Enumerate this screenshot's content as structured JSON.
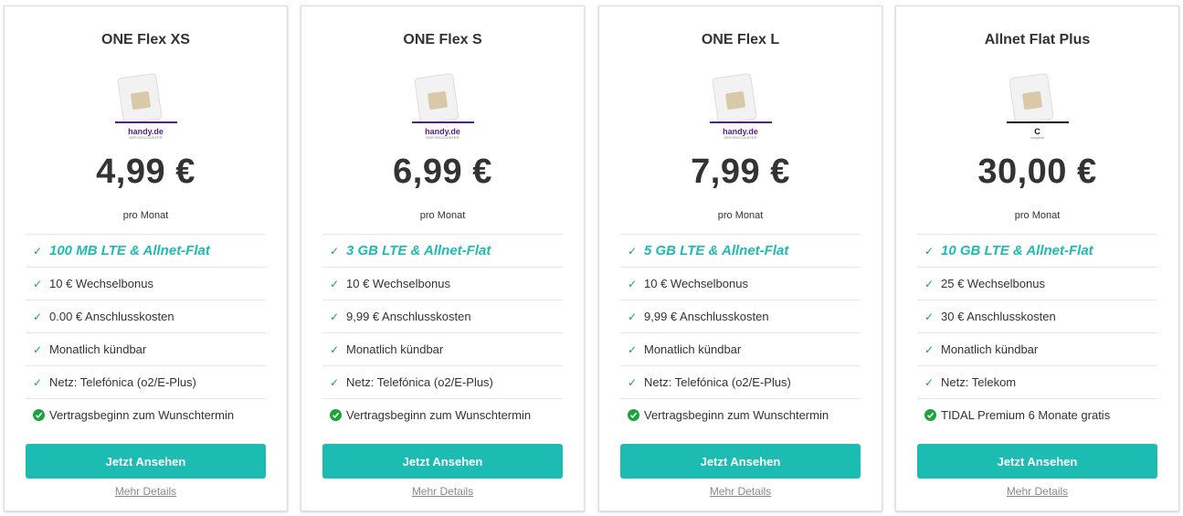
{
  "colors": {
    "accent": "#1cbcb3",
    "check": "#1aa53b",
    "brand_handy": "#5a1e8c"
  },
  "cards": [
    {
      "title": "ONE Flex XS",
      "brand": "handy.de",
      "brand_sub": "DER DISCOUNTER",
      "price": "4,99 €",
      "per": "pro Monat",
      "features": [
        "100 MB LTE & Allnet-Flat",
        "10 € Wechselbonus",
        "0.00 € Anschlusskosten",
        "Monatlich kündbar",
        "Netz: Telefónica (o2/E-Plus)",
        "Vertragsbeginn zum Wunschtermin"
      ],
      "cta": "Jetzt Ansehen",
      "details": "Mehr Details"
    },
    {
      "title": "ONE Flex S",
      "brand": "handy.de",
      "brand_sub": "DER DISCOUNTER",
      "price": "6,99 €",
      "per": "pro Monat",
      "features": [
        "3 GB LTE & Allnet-Flat",
        "10 € Wechselbonus",
        "9,99 € Anschlusskosten",
        "Monatlich kündbar",
        "Netz: Telefónica (o2/E-Plus)",
        "Vertragsbeginn zum Wunschtermin"
      ],
      "cta": "Jetzt Ansehen",
      "details": "Mehr Details"
    },
    {
      "title": "ONE Flex L",
      "brand": "handy.de",
      "brand_sub": "DER DISCOUNTER",
      "price": "7,99 €",
      "per": "pro Monat",
      "features": [
        "5 GB LTE & Allnet-Flat",
        "10 € Wechselbonus",
        "9,99 € Anschlusskosten",
        "Monatlich kündbar",
        "Netz: Telefónica (o2/E-Plus)",
        "Vertragsbeginn zum Wunschtermin"
      ],
      "cta": "Jetzt Ansehen",
      "details": "Mehr Details"
    },
    {
      "title": "Allnet Flat Plus",
      "brand": "C",
      "brand_sub": "congstar",
      "price": "30,00 €",
      "per": "pro Monat",
      "features": [
        "10 GB LTE & Allnet-Flat",
        "25 € Wechselbonus",
        "30 € Anschlusskosten",
        "Monatlich kündbar",
        "Netz: Telekom",
        "TIDAL Premium 6 Monate gratis"
      ],
      "cta": "Jetzt Ansehen",
      "details": "Mehr Details"
    }
  ]
}
